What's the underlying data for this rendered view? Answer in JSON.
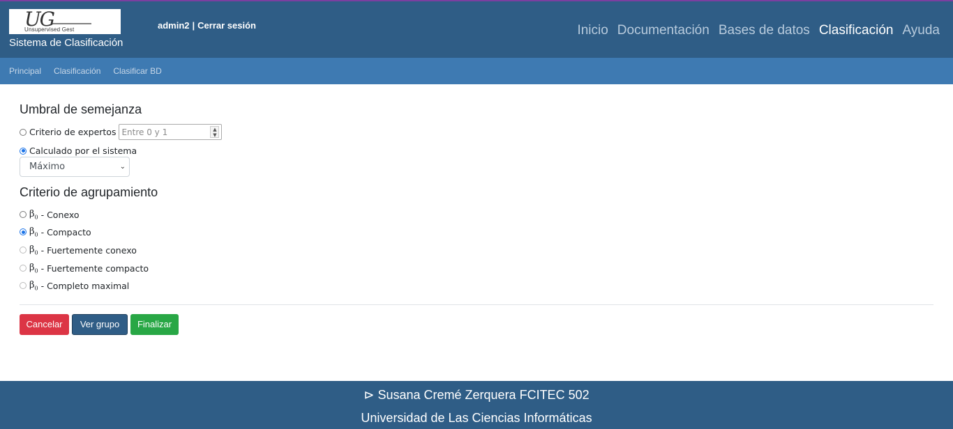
{
  "header": {
    "logo_text": "UG",
    "logo_subtitle": "Unsupervised Gest",
    "brand": "Sistema de Clasificación",
    "user": "admin2",
    "separator": "|",
    "logout": "Cerrar sesión",
    "nav": [
      "Inicio",
      "Documentación",
      "Bases de datos",
      "Clasificación",
      "Ayuda"
    ],
    "active_nav": "Clasificación"
  },
  "breadcrumb": [
    "Principal",
    "Clasificación",
    "Clasificar BD"
  ],
  "threshold": {
    "title": "Umbral de semejanza",
    "option_expert": "Criterio de expertos",
    "expert_placeholder": "Entre 0 y 1",
    "option_system": "Calculado por el sistema",
    "selected_option": "Calculado por el sistema",
    "select_value": "Máximo"
  },
  "grouping": {
    "title": "Criterio de agrupamiento",
    "symbol": "β",
    "subscript": "0",
    "options": [
      "- Conexo",
      "- Compacto",
      "- Fuertemente conexo",
      "- Fuertemente compacto",
      "- Completo maximal"
    ],
    "selected": "- Compacto"
  },
  "buttons": {
    "cancel": "Cancelar",
    "view_group": "Ver grupo",
    "finish": "Finalizar"
  },
  "footer": {
    "line1": "⊳ Susana Cremé Zerquera FCITEC 502",
    "line2": "Universidad de Las Ciencias Informáticas"
  },
  "colors": {
    "header_bg": "#2f5d86",
    "breadcrumb_bg": "#3e7ab2",
    "cancel": "#dc3545",
    "view_group": "#2f5d86",
    "finish": "#28a745"
  }
}
